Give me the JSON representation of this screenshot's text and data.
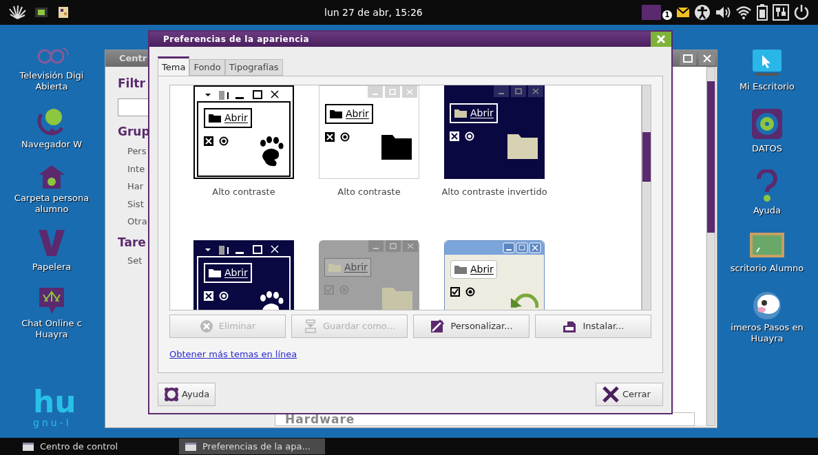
{
  "top_bar": {
    "clock": "lun 27 de abr, 15:26",
    "workspace_badge": "1"
  },
  "desktop_left": [
    {
      "kind": "tv",
      "lines": [
        "Televisión Digi",
        "Abierta"
      ]
    },
    {
      "kind": "globe",
      "lines": [
        "Navegador W"
      ]
    },
    {
      "kind": "home",
      "lines": [
        "Carpeta persona",
        "alumno"
      ]
    },
    {
      "kind": "trash",
      "lines": [
        "Papelera"
      ]
    },
    {
      "kind": "chat",
      "lines": [
        "Chat Online c",
        "Huayra"
      ]
    }
  ],
  "logo": {
    "text": "hu",
    "subtitle": "gnu-l"
  },
  "background_window": {
    "title": "Centr",
    "filter_heading": "Filtr",
    "groups_heading": "Grup",
    "groups": [
      "Pers",
      "Inte",
      "Har",
      "Sist",
      "Otra"
    ],
    "tasks_heading": "Tare",
    "tasks": [
      "Set"
    ],
    "section": "Hardware"
  },
  "dialog": {
    "title": "Preferencias de la apariencia",
    "tabs": [
      {
        "label": "Tema",
        "selected": true
      },
      {
        "label": "Fondo",
        "selected": false
      },
      {
        "label": "Tipografías",
        "selected": false
      }
    ],
    "themes": [
      {
        "kind": "contrast",
        "button": "Abrir",
        "name": "Alto contraste"
      },
      {
        "kind": "contrastfolder",
        "button": "Abrir",
        "name": "Alto contraste"
      },
      {
        "kind": "inverse",
        "button": "Abrir",
        "name": "Alto contraste invertido"
      },
      {
        "kind": "darkpaw",
        "button": "Abrir"
      },
      {
        "kind": "grey",
        "button": "Abrir"
      },
      {
        "kind": "classic",
        "button": "Abrir"
      }
    ],
    "buttons": [
      {
        "kind": "remove",
        "label": "Eliminar",
        "disabled": true
      },
      {
        "kind": "save",
        "label": "Guardar como...",
        "disabled": true
      },
      {
        "kind": "customize",
        "label": "Personalizar...",
        "disabled": false
      },
      {
        "kind": "install",
        "label": "Instalar...",
        "disabled": false
      }
    ],
    "link": "Obtener más temas en línea",
    "help": "Ayuda",
    "close": "Cerrar"
  },
  "desktop_right": [
    {
      "kind": "monitor",
      "lines": [
        "Mi Escritorio"
      ]
    },
    {
      "kind": "disk",
      "lines": [
        "DATOS"
      ]
    },
    {
      "kind": "help",
      "lines": [
        "Ayuda"
      ]
    },
    {
      "kind": "board",
      "lines": [
        "scritorio Alumno"
      ]
    },
    {
      "kind": "cow",
      "lines": [
        "imeros Pasos en",
        "Huayra"
      ]
    }
  ],
  "taskbar": [
    {
      "label": "Centro de control",
      "selected": false
    },
    {
      "label": "Preferencias de la apa...",
      "selected": true
    }
  ]
}
